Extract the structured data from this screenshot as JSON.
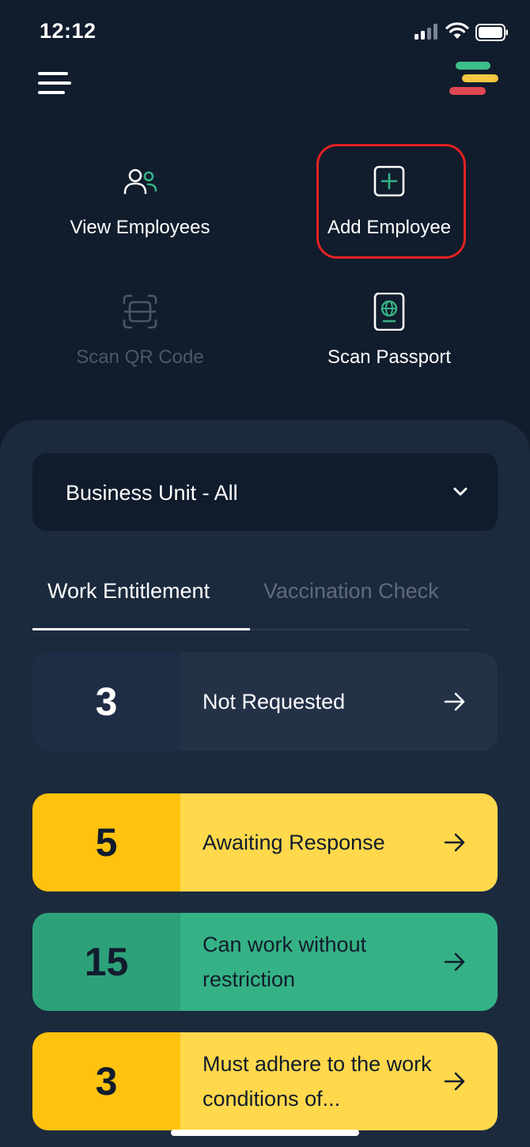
{
  "status_bar": {
    "time": "12:12"
  },
  "colors": {
    "background": "#111c2c",
    "panel": "#1c2a3d",
    "accent_green": "#35b285",
    "accent_yellow": "#ffd84c",
    "highlight_red": "#e32222",
    "logo_stripes": [
      "#3fbf8d",
      "#f5c842",
      "#e04852"
    ]
  },
  "header": {
    "menu_icon": "hamburger-menu-icon",
    "logo_icon": "brand-logo-icon"
  },
  "quick_actions": [
    {
      "label": "View Employees",
      "icon": "people-icon",
      "enabled": true
    },
    {
      "label": "Add Employee",
      "icon": "plus-square-icon",
      "enabled": true,
      "highlighted": true
    },
    {
      "label": "Scan QR Code",
      "icon": "scan-frame-icon",
      "enabled": false
    },
    {
      "label": "Scan Passport",
      "icon": "passport-icon",
      "enabled": true
    }
  ],
  "business_unit": {
    "label": "Business Unit - All",
    "icon": "chevron-down-icon"
  },
  "tabs": [
    {
      "label": "Work Entitlement",
      "active": true
    },
    {
      "label": "Vaccination Check",
      "active": false
    }
  ],
  "status_cards": [
    {
      "count": "3",
      "label": "Not Requested",
      "count_bg": "#1f2c45",
      "body_bg": "#243248",
      "text_color": "#ffffff",
      "arrow_icon": "arrow-right-icon"
    },
    {
      "count": "5",
      "label": "Awaiting Response",
      "count_bg": "#ffc20e",
      "body_bg": "#ffd84c",
      "text_color": "#111c2c",
      "arrow_icon": "arrow-right-icon"
    },
    {
      "count": "15",
      "label": "Can work without restriction",
      "count_bg": "#2da27a",
      "body_bg": "#35b285",
      "text_color": "#111c2c",
      "arrow_icon": "arrow-right-icon"
    },
    {
      "count": "3",
      "label": "Must adhere to the work conditions of...",
      "count_bg": "#ffc20e",
      "body_bg": "#ffd84c",
      "text_color": "#111c2c",
      "arrow_icon": "arrow-right-icon"
    }
  ]
}
